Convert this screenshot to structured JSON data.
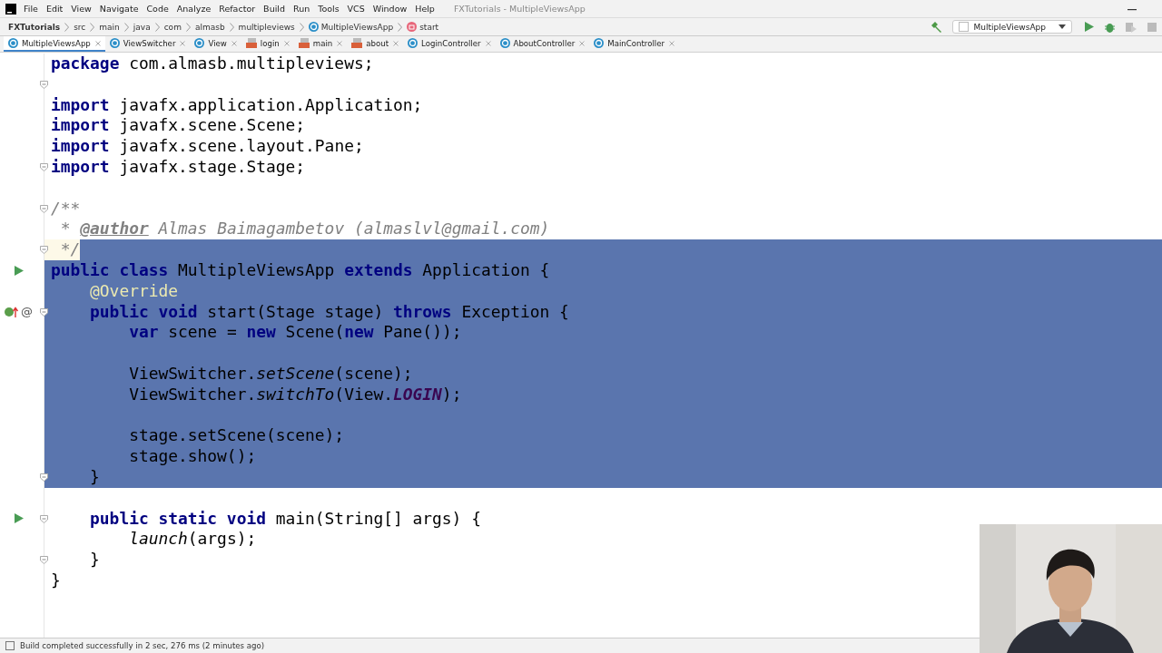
{
  "window": {
    "title": "FXTutorials - MultipleViewsApp"
  },
  "menu": [
    "File",
    "Edit",
    "View",
    "Navigate",
    "Code",
    "Analyze",
    "Refactor",
    "Build",
    "Run",
    "Tools",
    "VCS",
    "Window",
    "Help"
  ],
  "breadcrumbs": [
    {
      "label": "FXTutorials",
      "kind": "project"
    },
    {
      "label": "src",
      "kind": "folder"
    },
    {
      "label": "main",
      "kind": "folder"
    },
    {
      "label": "java",
      "kind": "folder"
    },
    {
      "label": "com",
      "kind": "folder"
    },
    {
      "label": "almasb",
      "kind": "folder"
    },
    {
      "label": "multipleviews",
      "kind": "folder"
    },
    {
      "label": "MultipleViewsApp",
      "kind": "class"
    },
    {
      "label": "start",
      "kind": "method"
    }
  ],
  "run_config": "MultipleViewsApp",
  "tabs": [
    {
      "label": "MultipleViewsApp",
      "kind": "class",
      "selected": true
    },
    {
      "label": "ViewSwitcher",
      "kind": "class",
      "selected": false
    },
    {
      "label": "View",
      "kind": "class",
      "selected": false
    },
    {
      "label": "login",
      "kind": "fxml",
      "selected": false
    },
    {
      "label": "main",
      "kind": "fxml",
      "selected": false
    },
    {
      "label": "about",
      "kind": "fxml",
      "selected": false
    },
    {
      "label": "LoginController",
      "kind": "class",
      "selected": false
    },
    {
      "label": "AboutController",
      "kind": "class",
      "selected": false
    },
    {
      "label": "MainController",
      "kind": "class",
      "selected": false
    }
  ],
  "lines": [
    {
      "tokens": [
        {
          "text": "package",
          "kind": "keyword"
        },
        {
          "text": " com.almasb.multipleviews;",
          "kind": "plain"
        }
      ],
      "selected": false,
      "current": false,
      "fold": false
    },
    {
      "selected": false,
      "current": false,
      "fold": true
    },
    {
      "tokens": [
        {
          "text": "import",
          "kind": "keyword"
        },
        {
          "text": " javafx.application.Application;",
          "kind": "plain"
        }
      ],
      "selected": false,
      "current": false,
      "fold": false
    },
    {
      "tokens": [
        {
          "text": "import",
          "kind": "keyword"
        },
        {
          "text": " javafx.scene.Scene;",
          "kind": "plain"
        }
      ],
      "selected": false,
      "current": false,
      "fold": false
    },
    {
      "tokens": [
        {
          "text": "import",
          "kind": "keyword"
        },
        {
          "text": " javafx.scene.layout.Pane;",
          "kind": "plain"
        }
      ],
      "selected": false,
      "current": false,
      "fold": false
    },
    {
      "tokens": [
        {
          "text": "import",
          "kind": "keyword"
        },
        {
          "text": " javafx.stage.Stage;",
          "kind": "plain"
        }
      ],
      "selected": false,
      "current": false,
      "fold": true
    },
    {
      "selected": false,
      "current": false,
      "fold": false
    },
    {
      "tokens": [
        {
          "text": "/**",
          "kind": "comment"
        }
      ],
      "selected": false,
      "current": false,
      "fold": true
    },
    {
      "tokens": [
        {
          "text": " * ",
          "kind": "comment"
        },
        {
          "text": "@author",
          "kind": "doctag"
        },
        {
          "text": " Almas Baimagambetov (almaslvl@gmail.com)",
          "kind": "comment"
        }
      ],
      "selected": false,
      "current": false,
      "fold": false
    },
    {
      "tokens": [
        {
          "text": " */",
          "kind": "comment"
        }
      ],
      "selected": true,
      "current": true,
      "fold": true
    },
    {
      "tokens": [
        {
          "text": "public class",
          "kind": "keyword"
        },
        {
          "text": " MultipleViewsApp ",
          "kind": "plain"
        },
        {
          "text": "extends",
          "kind": "keyword"
        },
        {
          "text": " Application {",
          "kind": "plain"
        }
      ],
      "selected": true,
      "current": false,
      "fold": false,
      "kind": "run",
      "children": [
        {
          "tokens": [
            {
              "text": "@Override",
              "kind": "annotation"
            }
          ],
          "selected": true,
          "current": false,
          "fold": false
        },
        {
          "tokens": [
            {
              "text": "public void",
              "kind": "keyword"
            },
            {
              "text": " start(Stage stage) ",
              "kind": "plain"
            },
            {
              "text": "throws",
              "kind": "keyword"
            },
            {
              "text": " Exception {",
              "kind": "plain"
            }
          ],
          "selected": true,
          "current": false,
          "fold": true,
          "kind": "override",
          "marker": "@",
          "children": [
            {
              "tokens": [
                {
                  "text": "var",
                  "kind": "keyword"
                },
                {
                  "text": " scene = ",
                  "kind": "plain"
                },
                {
                  "text": "new",
                  "kind": "keyword"
                },
                {
                  "text": " Scene(",
                  "kind": "plain"
                },
                {
                  "text": "new",
                  "kind": "keyword"
                },
                {
                  "text": " Pane());",
                  "kind": "plain"
                }
              ],
              "selected": true,
              "current": false,
              "fold": false
            },
            {
              "selected": true,
              "current": false,
              "fold": false
            },
            {
              "tokens": [
                {
                  "text": "ViewSwitcher.",
                  "kind": "plain"
                },
                {
                  "text": "setScene",
                  "kind": "static"
                },
                {
                  "text": "(scene);",
                  "kind": "plain"
                }
              ],
              "selected": true,
              "current": false,
              "fold": false
            },
            {
              "tokens": [
                {
                  "text": "ViewSwitcher.",
                  "kind": "plain"
                },
                {
                  "text": "switchTo",
                  "kind": "static"
                },
                {
                  "text": "(View.",
                  "kind": "plain"
                },
                {
                  "text": "LOGIN",
                  "kind": "constant"
                },
                {
                  "text": ");",
                  "kind": "plain"
                }
              ],
              "selected": true,
              "current": false,
              "fold": false
            },
            {
              "selected": true,
              "current": false,
              "fold": false
            },
            {
              "tokens": [
                {
                  "text": "stage.setScene(scene);",
                  "kind": "plain"
                }
              ],
              "selected": true,
              "current": false,
              "fold": false
            },
            {
              "tokens": [
                {
                  "text": "stage.show();",
                  "kind": "plain"
                }
              ],
              "selected": true,
              "current": false,
              "fold": false
            }
          ]
        },
        {
          "tokens": [
            {
              "text": "}",
              "kind": "plain"
            }
          ],
          "selected": true,
          "current": false,
          "fold": true
        },
        {
          "selected": false,
          "current": false,
          "fold": false
        },
        {
          "tokens": [
            {
              "text": "public static void",
              "kind": "keyword"
            },
            {
              "text": " main(String[] args) {",
              "kind": "plain"
            }
          ],
          "selected": false,
          "current": false,
          "fold": true,
          "kind": "run",
          "children": [
            {
              "tokens": [
                {
                  "text": "launch",
                  "kind": "static"
                },
                {
                  "text": "(args);",
                  "kind": "plain"
                }
              ],
              "selected": false,
              "current": false,
              "fold": false
            }
          ]
        },
        {
          "tokens": [
            {
              "text": "}",
              "kind": "plain"
            }
          ],
          "selected": false,
          "current": false,
          "fold": true
        }
      ]
    },
    {
      "tokens": [
        {
          "text": "}",
          "kind": "plain"
        }
      ],
      "selected": false,
      "current": false,
      "fold": false
    }
  ],
  "status_bar": {
    "message": "Build completed successfully in 2 sec, 276 ms (2 minutes ago)"
  }
}
